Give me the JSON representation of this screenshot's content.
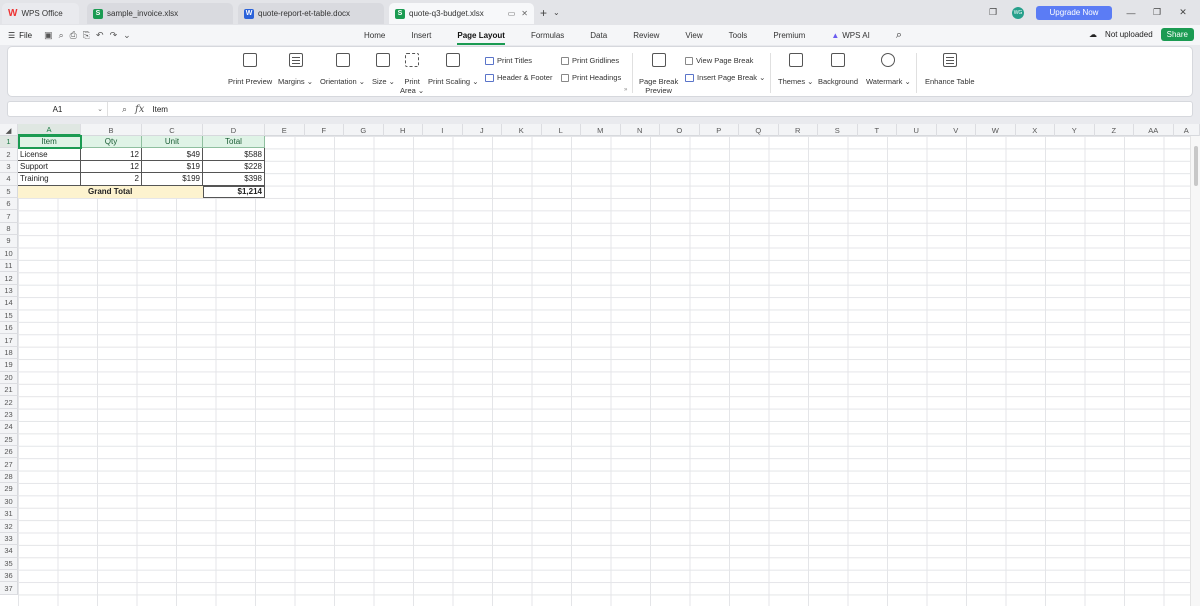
{
  "titlebar": {
    "app_tab": "WPS Office",
    "tabs": [
      {
        "label": "sample_invoice.xlsx",
        "icon": "S"
      },
      {
        "label": "quote-report-et-table.docx",
        "icon": "W"
      },
      {
        "label": "quote-q3-budget.xlsx",
        "icon": "S"
      }
    ],
    "avatar_text": "WG",
    "upgrade_label": "Upgrade Now"
  },
  "menubar": {
    "file_label": "File",
    "menus": [
      "Home",
      "Insert",
      "Page Layout",
      "Formulas",
      "Data",
      "Review",
      "View",
      "Tools",
      "Premium"
    ],
    "active_menu": "Page Layout",
    "wps_ai_label": "WPS AI",
    "not_uploaded_label": "Not uploaded",
    "share_label": "Share"
  },
  "ribbon": {
    "print_preview": "Print Preview",
    "margins": "Margins",
    "orientation": "Orientation",
    "size": "Size",
    "print_area_1": "Print",
    "print_area_2": "Area",
    "print_scaling": "Print Scaling",
    "print_titles": "Print Titles",
    "header_footer": "Header & Footer",
    "print_gridlines": "Print Gridlines",
    "print_headings": "Print Headings",
    "page_break_preview_1": "Page Break",
    "page_break_preview_2": "Preview",
    "view_page_break": "View Page Break",
    "insert_page_break": "Insert Page Break",
    "themes": "Themes",
    "background": "Background",
    "watermark": "Watermark",
    "enhance_table": "Enhance Table"
  },
  "formula_bar": {
    "name_box": "A1",
    "fx_label": "fx",
    "content": "Item"
  },
  "sheet": {
    "columns": [
      "A",
      "B",
      "C",
      "D",
      "E",
      "F",
      "G",
      "H",
      "I",
      "J",
      "K",
      "L",
      "M",
      "N",
      "O",
      "P",
      "Q",
      "R",
      "S",
      "T",
      "U",
      "V",
      "W",
      "X",
      "Y",
      "Z",
      "AA",
      "A"
    ],
    "rows": [
      "1",
      "2",
      "3",
      "4",
      "5",
      "6",
      "7",
      "8",
      "9",
      "10",
      "11",
      "12",
      "13",
      "14",
      "15",
      "16",
      "17",
      "18",
      "19",
      "20",
      "21",
      "22",
      "23",
      "24",
      "25",
      "26",
      "27",
      "28",
      "29",
      "30",
      "31",
      "32",
      "33",
      "34",
      "35",
      "36",
      "37"
    ],
    "table_headers": [
      "Item",
      "Qty",
      "Unit",
      "Total"
    ],
    "table_rows": [
      [
        "License",
        "12",
        "$49",
        "$588"
      ],
      [
        "Support",
        "12",
        "$19",
        "$228"
      ],
      [
        "Training",
        "2",
        "$199",
        "$398"
      ]
    ],
    "grand_total_label": "Grand Total",
    "grand_total_value": "$1,214"
  }
}
